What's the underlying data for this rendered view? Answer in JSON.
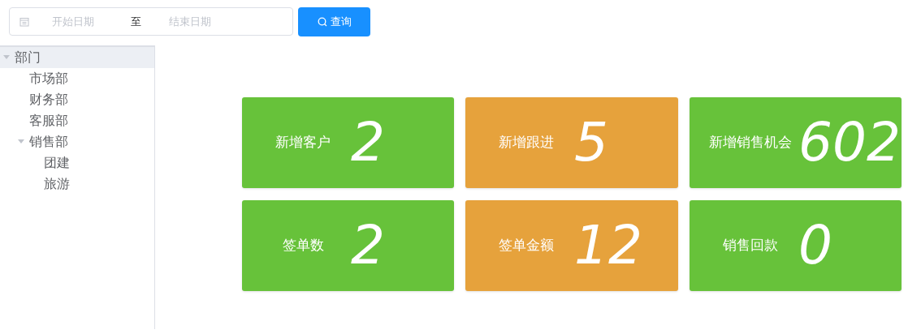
{
  "date_range": {
    "start_placeholder": "开始日期",
    "separator": "至",
    "end_placeholder": "结束日期"
  },
  "query_button": {
    "label": "查询"
  },
  "tree": {
    "nodes": [
      {
        "label": "部门",
        "selected": true,
        "expanded": true,
        "children": [
          {
            "label": "市场部",
            "selected": false
          },
          {
            "label": "财务部",
            "selected": false
          },
          {
            "label": "客服部",
            "selected": false
          },
          {
            "label": "销售部",
            "selected": false,
            "expanded": true,
            "children": [
              {
                "label": "团建",
                "selected": false
              },
              {
                "label": "旅游",
                "selected": false
              }
            ]
          }
        ]
      }
    ]
  },
  "cards": [
    {
      "label": "新增客户",
      "value": "2",
      "color": "#67c23a"
    },
    {
      "label": "新增跟进",
      "value": "5",
      "color": "#e6a23c"
    },
    {
      "label": "新增销售机会",
      "value": "602",
      "color": "#67c23a"
    },
    {
      "label": "签单数",
      "value": "2",
      "color": "#67c23a"
    },
    {
      "label": "签单金额",
      "value": "12",
      "color": "#e6a23c"
    },
    {
      "label": "销售回款",
      "value": "0",
      "color": "#67c23a"
    }
  ]
}
